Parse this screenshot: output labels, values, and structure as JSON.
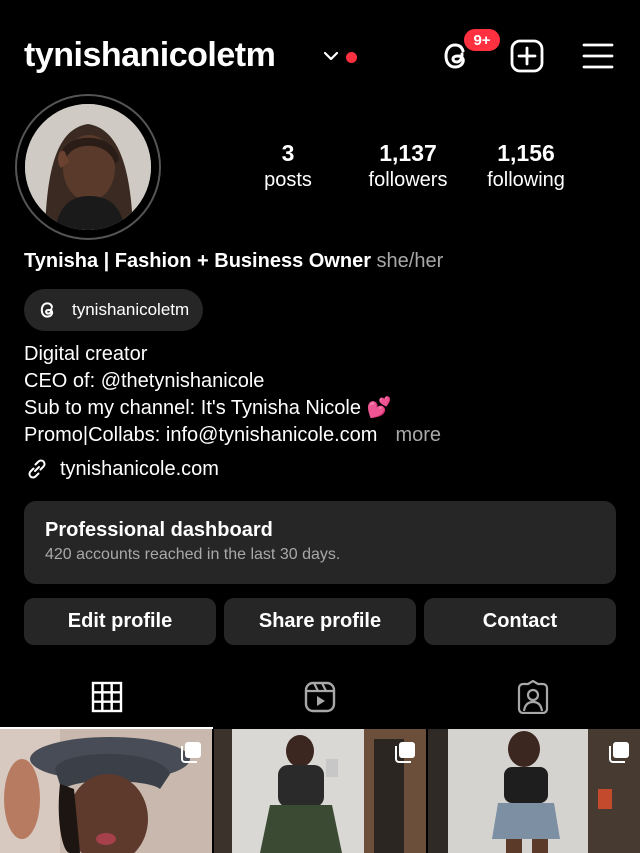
{
  "header": {
    "username": "tynishanicoletm",
    "notification_badge": "9+",
    "icons": [
      "chevron-down-icon",
      "threads-icon",
      "add-post-icon",
      "menu-icon"
    ],
    "accent_color": "#ff3040"
  },
  "stats": [
    {
      "value": "3",
      "label": "posts"
    },
    {
      "value": "1,137",
      "label": "followers"
    },
    {
      "value": "1,156",
      "label": "following"
    }
  ],
  "profile": {
    "name": "Tynisha | Fashion + Business Owner",
    "pronouns": "she/her",
    "threads_handle": "tynishanicoletm",
    "bio": [
      "Digital creator",
      "CEO of: @thetynishanicole",
      "Sub to my channel: It's Tynisha Nicole 💕",
      "Promo|Collabs: info@tynishanicole.com"
    ],
    "more_label": "more",
    "link": "tynishanicole.com"
  },
  "dashboard": {
    "title": "Professional dashboard",
    "subtitle": "420 accounts reached in the last 30 days."
  },
  "buttons": {
    "edit": "Edit profile",
    "share": "Share profile",
    "contact": "Contact"
  },
  "tabs": [
    "grid-icon",
    "reels-icon",
    "tagged-icon"
  ]
}
